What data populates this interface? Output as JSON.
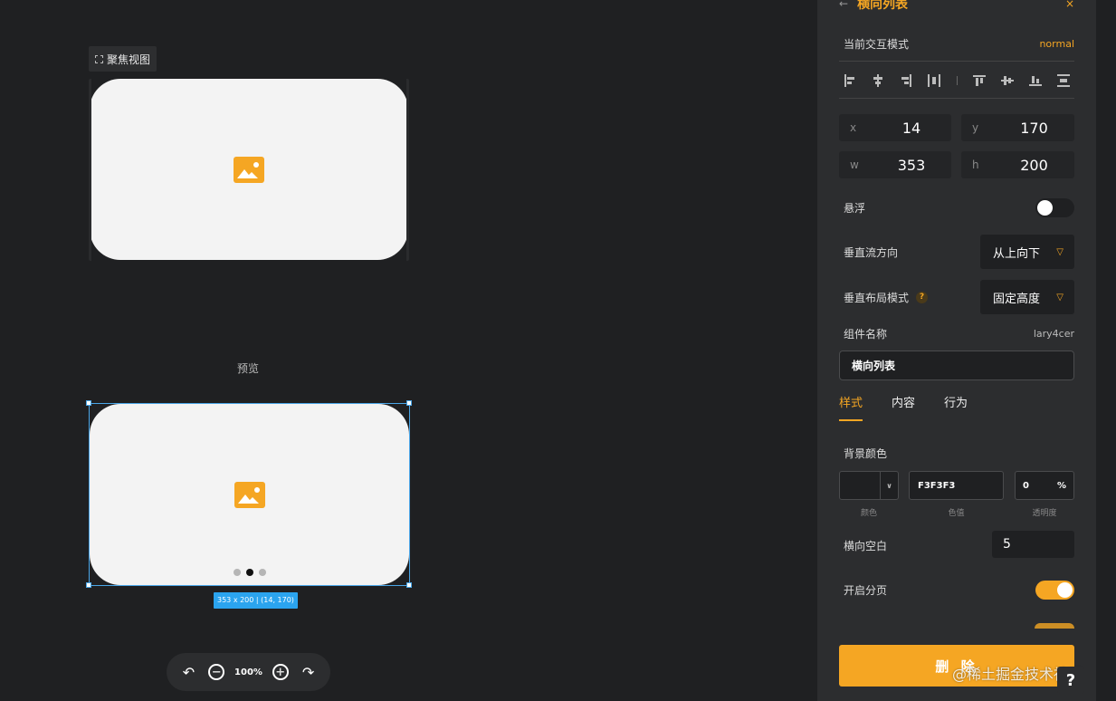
{
  "canvas": {
    "focus_view_label": "聚焦视图",
    "preview_label": "预览",
    "dimension_badge": "353 x 200 | (14, 170)",
    "carousel_dots": 3,
    "active_dot": 1,
    "zoom_level": "100%"
  },
  "panel": {
    "back_icon": "←",
    "title": "横向列表",
    "close_icon": "×",
    "interaction_mode_label": "当前交互模式",
    "interaction_mode_value": "normal",
    "position": {
      "x_label": "x",
      "x": "14",
      "y_label": "y",
      "y": "170",
      "w_label": "w",
      "w": "353",
      "h_label": "h",
      "h": "200"
    },
    "float_label": "悬浮",
    "float_on": false,
    "flow_direction_label": "垂直流方向",
    "flow_direction_value": "从上向下",
    "layout_mode_label": "垂直布局模式",
    "layout_mode_help": "?",
    "layout_mode_value": "固定高度",
    "component_name_label": "组件名称",
    "component_id": "lary4cer",
    "component_name_value": "横向列表",
    "tabs": [
      {
        "label": "样式",
        "active": true
      },
      {
        "label": "内容",
        "active": false
      },
      {
        "label": "行为",
        "active": false
      }
    ],
    "bg_color_label": "背景颜色",
    "color_swatch_label": "颜色",
    "color_value": "F3F3F3",
    "color_value_label": "色值",
    "opacity_value": "0",
    "opacity_unit": "%",
    "opacity_label": "透明度",
    "h_gap_label": "横向空白",
    "h_gap_value": "5",
    "pagination_label": "开启分页",
    "pagination_on": true,
    "delete_label": "删 除",
    "help_label": "?"
  },
  "watermark": "@稀土掘金技术社区",
  "colors": {
    "accent": "#f5a623",
    "selection": "#4aa6e8",
    "badge": "#2ba4ef"
  }
}
